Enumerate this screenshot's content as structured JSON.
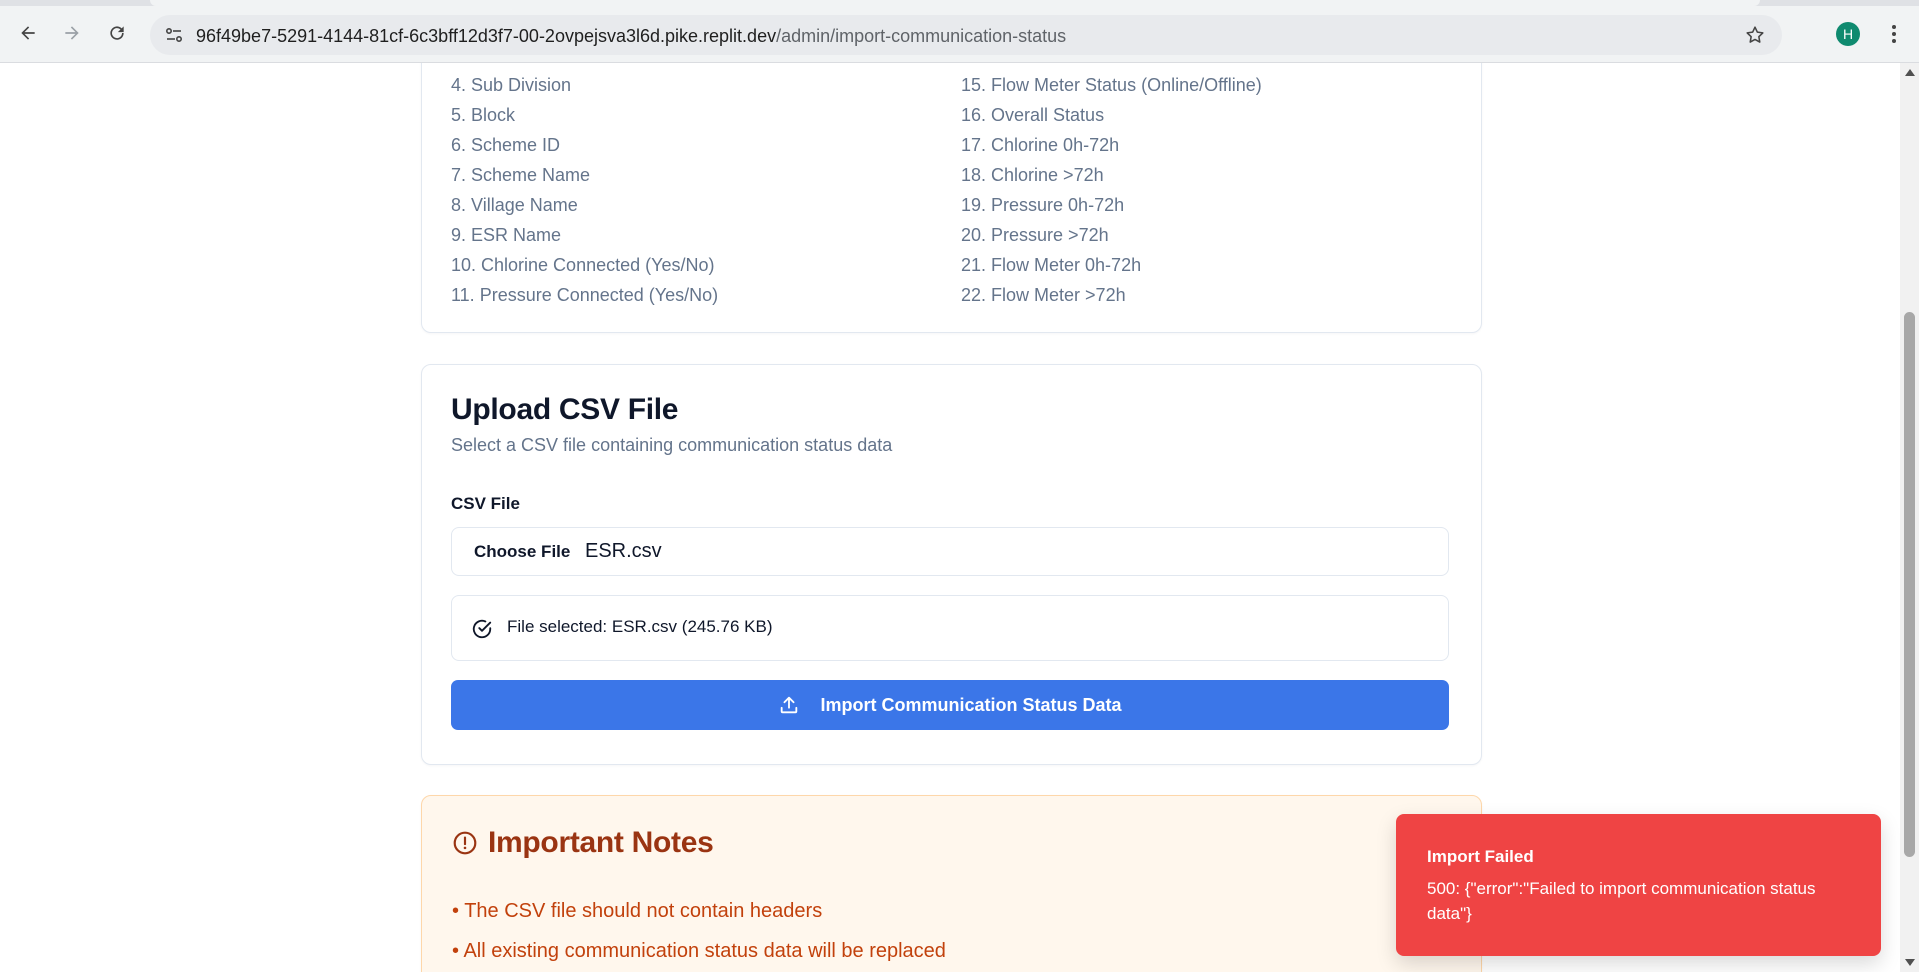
{
  "browser": {
    "url_host": "96f49be7-5291-4144-81cf-6c3bff12d3f7-00-2ovpejsva3l6d.pike.replit.dev",
    "url_path": "/admin/import-communication-status",
    "profile_initial": "H",
    "icons": {
      "back": "back-arrow-icon",
      "forward": "forward-arrow-icon",
      "reload": "reload-icon",
      "site_info": "site-info-icon",
      "bookmark": "star-icon",
      "menu": "more-vert-icon"
    }
  },
  "columns": {
    "left": [
      "4. Sub Division",
      "5. Block",
      "6. Scheme ID",
      "7. Scheme Name",
      "8. Village Name",
      "9. ESR Name",
      "10. Chlorine Connected (Yes/No)",
      "11. Pressure Connected (Yes/No)"
    ],
    "right": [
      "15. Flow Meter Status (Online/Offline)",
      "16. Overall Status",
      "17. Chlorine 0h-72h",
      "18. Chlorine >72h",
      "19. Pressure 0h-72h",
      "20. Pressure >72h",
      "21. Flow Meter 0h-72h",
      "22. Flow Meter >72h"
    ]
  },
  "upload": {
    "title": "Upload CSV File",
    "subtitle": "Select a CSV file containing communication status data",
    "field_label": "CSV File",
    "choose_file_label": "Choose File",
    "file_name": "ESR.csv",
    "selected_text": "File selected: ESR.csv (245.76 KB)",
    "import_button_label": "Import Communication Status Data"
  },
  "notes": {
    "title": "Important Notes",
    "items": [
      "• The CSV file should not contain headers",
      "• All existing communication status data will be replaced"
    ]
  },
  "toast": {
    "title": "Import Failed",
    "message": "500: {\"error\":\"Failed to import communication status data\"}"
  },
  "colors": {
    "primary": "#3b76e8",
    "toast_bg": "#ef4444",
    "notes_bg": "#fff7ed",
    "notes_text": "#c2410c"
  }
}
